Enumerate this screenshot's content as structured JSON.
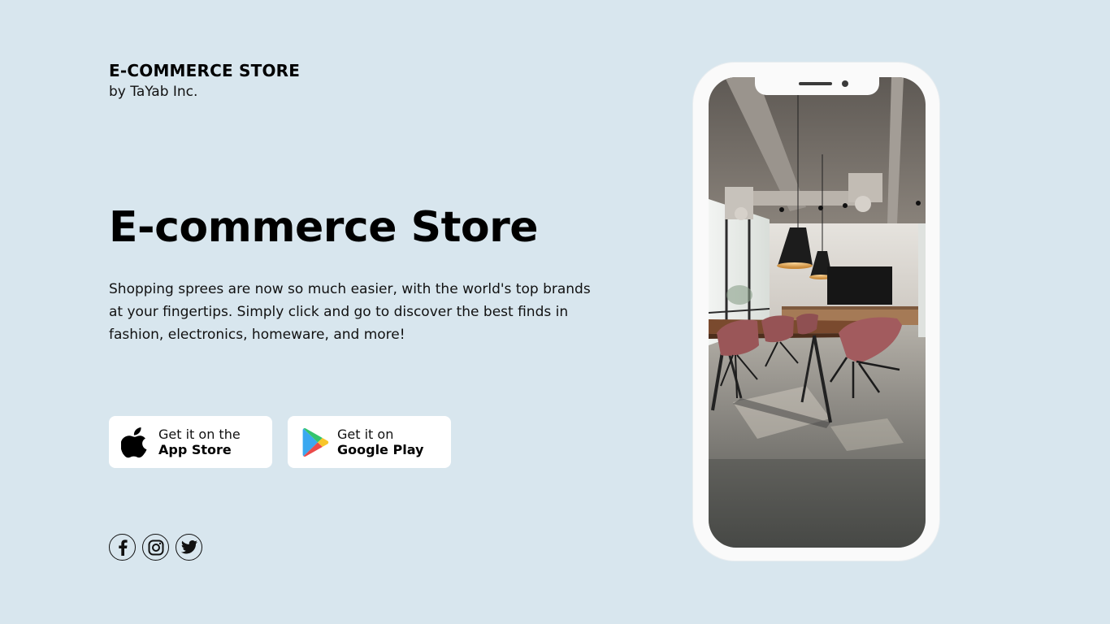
{
  "brand": {
    "title": "E-COMMERCE STORE",
    "subtitle": "by TaYab Inc."
  },
  "hero": {
    "title": "E-commerce Store",
    "description": "Shopping sprees are now so much easier, with the world's top brands at your fingertips. Simply click and go to discover the best finds in fashion, electronics, homeware, and more!"
  },
  "store_buttons": {
    "apple": {
      "small": "Get it on the",
      "big": "App Store",
      "icon": "apple-icon"
    },
    "google": {
      "small": "Get it on",
      "big": "Google Play",
      "icon": "google-play-icon"
    }
  },
  "social": {
    "icons": [
      "facebook-icon",
      "instagram-icon",
      "twitter-icon"
    ]
  },
  "phone": {
    "screen_image": "office-interior-photo"
  },
  "colors": {
    "background": "#d8e6ee",
    "button_bg": "#ffffff",
    "text": "#000000",
    "phone_frame": "#fafafa"
  }
}
